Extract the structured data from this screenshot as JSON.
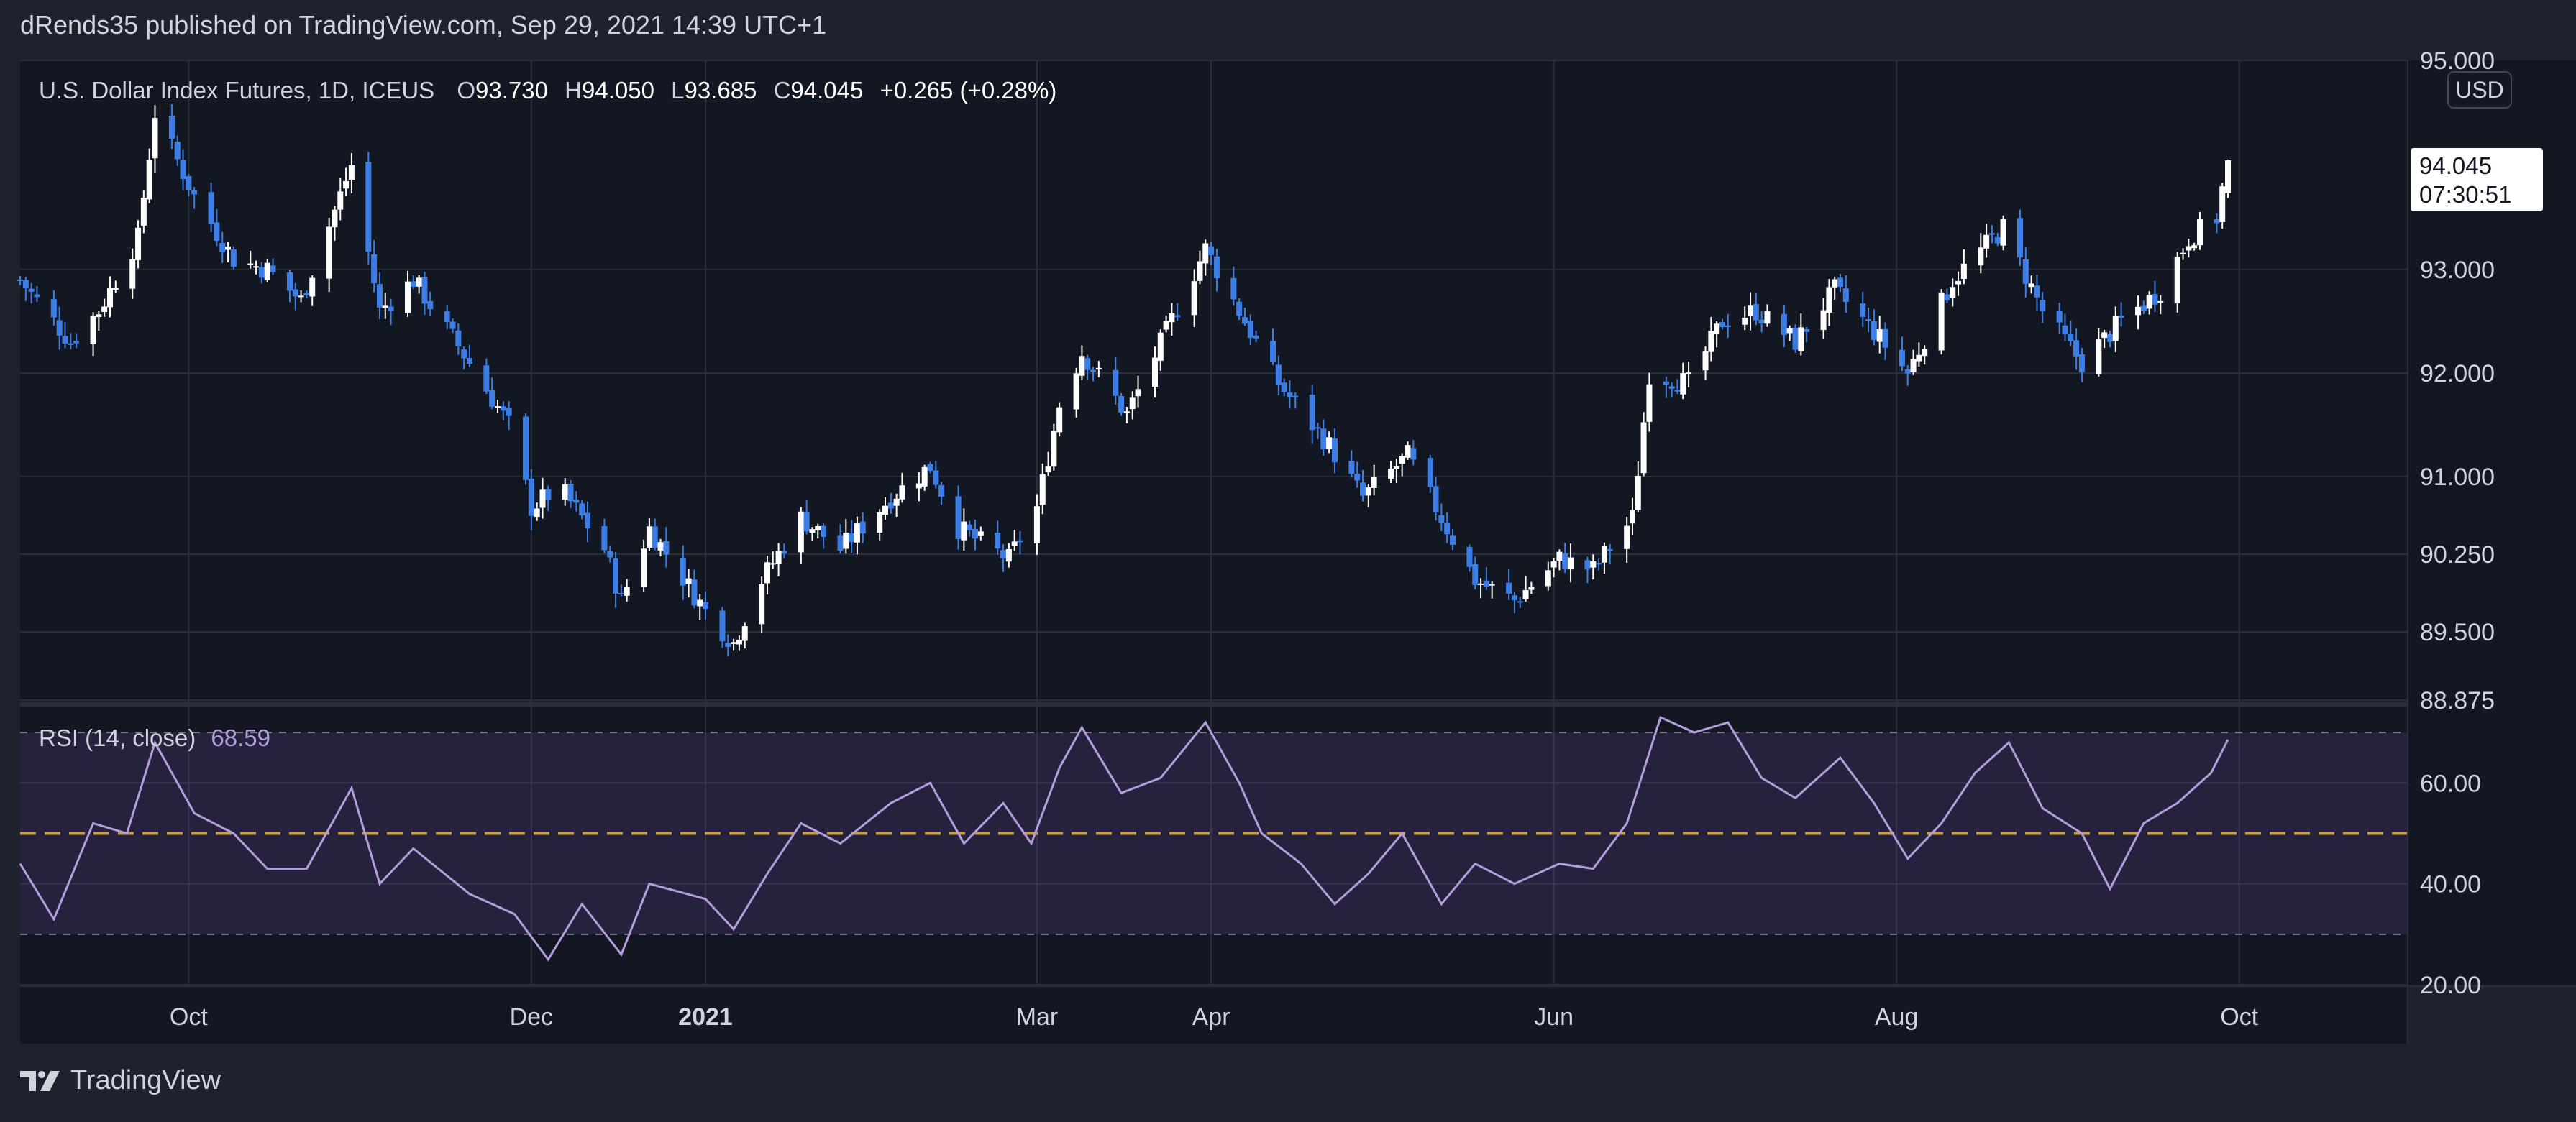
{
  "header": {
    "publisher": "dRends35 published on TradingView.com, Sep 29, 2021 14:39 UTC+1"
  },
  "footer": {
    "brand": "TradingView"
  },
  "colors": {
    "background": "#131722",
    "frame": "#1e222d",
    "grid": "#2a2e39",
    "up_candle": "#ffffff",
    "down_candle": "#3d7ee6",
    "rsi_line": "#b39ddb",
    "rsi_band": "#7e57c2",
    "rsi_mid": "#c9a14a",
    "text": "#d1d4dc"
  },
  "legend": {
    "symbol": "U.S. Dollar Index Futures, 1D, ICEUS",
    "o_label": "O",
    "o": "93.730",
    "h_label": "H",
    "h": "94.050",
    "l_label": "L",
    "l": "93.685",
    "c_label": "C",
    "c": "94.045",
    "change": "+0.265 (+0.28%)"
  },
  "price_axis": {
    "currency": "USD",
    "last_price": "94.045",
    "countdown": "07:30:51"
  },
  "rsi": {
    "label": "RSI (14, close)",
    "value": "68.59"
  },
  "chart_data": [
    {
      "type": "candlestick",
      "title": "U.S. Dollar Index Futures, 1D, ICEUS",
      "y_ticks": [
        "95.000",
        "93.000",
        "92.000",
        "91.000",
        "90.250",
        "89.500",
        "88.875"
      ],
      "x_ticks": [
        "Oct",
        "Dec",
        "2021",
        "Mar",
        "Apr",
        "Jun",
        "Aug",
        "Oct"
      ],
      "x_range": [
        "2020-09-01",
        "2021-10-31"
      ],
      "key_points": [
        {
          "date": "2020-09-01",
          "close": 92.9
        },
        {
          "date": "2020-09-10",
          "close": 92.3
        },
        {
          "date": "2020-09-15",
          "close": 92.6
        },
        {
          "date": "2020-09-22",
          "close": 93.3
        },
        {
          "date": "2020-09-25",
          "close": 94.5
        },
        {
          "date": "2020-10-02",
          "close": 93.7
        },
        {
          "date": "2020-10-09",
          "close": 93.1
        },
        {
          "date": "2020-10-15",
          "close": 93.0
        },
        {
          "date": "2020-10-21",
          "close": 92.7
        },
        {
          "date": "2020-10-30",
          "close": 94.0
        },
        {
          "date": "2020-11-04",
          "close": 92.6
        },
        {
          "date": "2020-11-10",
          "close": 92.9
        },
        {
          "date": "2020-11-20",
          "close": 92.1
        },
        {
          "date": "2020-11-27",
          "close": 91.5
        },
        {
          "date": "2020-12-01",
          "close": 90.7
        },
        {
          "date": "2020-12-06",
          "close": 90.9
        },
        {
          "date": "2020-12-14",
          "close": 90.3
        },
        {
          "date": "2020-12-17",
          "close": 89.8
        },
        {
          "date": "2020-12-22",
          "close": 90.5
        },
        {
          "date": "2021-01-01",
          "close": 89.7
        },
        {
          "date": "2021-01-06",
          "close": 89.4
        },
        {
          "date": "2021-01-11",
          "close": 90.0
        },
        {
          "date": "2021-01-18",
          "close": 90.6
        },
        {
          "date": "2021-01-25",
          "close": 90.3
        },
        {
          "date": "2021-02-03",
          "close": 90.8
        },
        {
          "date": "2021-02-10",
          "close": 91.1
        },
        {
          "date": "2021-02-15",
          "close": 90.5
        },
        {
          "date": "2021-02-24",
          "close": 90.2
        },
        {
          "date": "2021-03-01",
          "close": 90.7
        },
        {
          "date": "2021-03-05",
          "close": 91.7
        },
        {
          "date": "2021-03-09",
          "close": 92.2
        },
        {
          "date": "2021-03-17",
          "close": 91.6
        },
        {
          "date": "2021-03-24",
          "close": 92.4
        },
        {
          "date": "2021-03-31",
          "close": 93.2
        },
        {
          "date": "2021-04-06",
          "close": 92.6
        },
        {
          "date": "2021-04-13",
          "close": 91.9
        },
        {
          "date": "2021-04-22",
          "close": 91.3
        },
        {
          "date": "2021-04-28",
          "close": 90.8
        },
        {
          "date": "2021-05-06",
          "close": 91.2
        },
        {
          "date": "2021-05-12",
          "close": 90.6
        },
        {
          "date": "2021-05-18",
          "close": 90.0
        },
        {
          "date": "2021-05-25",
          "close": 89.8
        },
        {
          "date": "2021-06-02",
          "close": 90.2
        },
        {
          "date": "2021-06-08",
          "close": 90.1
        },
        {
          "date": "2021-06-15",
          "close": 90.6
        },
        {
          "date": "2021-06-18",
          "close": 92.0
        },
        {
          "date": "2021-06-25",
          "close": 91.9
        },
        {
          "date": "2021-07-01",
          "close": 92.5
        },
        {
          "date": "2021-07-07",
          "close": 92.6
        },
        {
          "date": "2021-07-14",
          "close": 92.3
        },
        {
          "date": "2021-07-21",
          "close": 92.8
        },
        {
          "date": "2021-07-28",
          "close": 92.4
        },
        {
          "date": "2021-08-03",
          "close": 92.0
        },
        {
          "date": "2021-08-11",
          "close": 92.9
        },
        {
          "date": "2021-08-20",
          "close": 93.4
        },
        {
          "date": "2021-08-27",
          "close": 92.6
        },
        {
          "date": "2021-09-03",
          "close": 92.1
        },
        {
          "date": "2021-09-10",
          "close": 92.5
        },
        {
          "date": "2021-09-17",
          "close": 92.8
        },
        {
          "date": "2021-09-22",
          "close": 93.3
        },
        {
          "date": "2021-09-27",
          "close": 93.5
        },
        {
          "date": "2021-09-29",
          "close": 94.045
        }
      ]
    },
    {
      "type": "line",
      "title": "RSI (14, close)",
      "y_ticks": [
        "60.00",
        "40.00",
        "20.00"
      ],
      "ylim": [
        20,
        75
      ],
      "bands": {
        "upper": 70,
        "middle": 50,
        "lower": 30
      },
      "points": [
        {
          "date": "2020-09-01",
          "y": 44
        },
        {
          "date": "2020-09-07",
          "y": 33
        },
        {
          "date": "2020-09-14",
          "y": 52
        },
        {
          "date": "2020-09-20",
          "y": 50
        },
        {
          "date": "2020-09-25",
          "y": 68
        },
        {
          "date": "2020-10-02",
          "y": 54
        },
        {
          "date": "2020-10-09",
          "y": 50
        },
        {
          "date": "2020-10-15",
          "y": 43
        },
        {
          "date": "2020-10-22",
          "y": 43
        },
        {
          "date": "2020-10-30",
          "y": 59
        },
        {
          "date": "2020-11-04",
          "y": 40
        },
        {
          "date": "2020-11-10",
          "y": 47
        },
        {
          "date": "2020-11-20",
          "y": 38
        },
        {
          "date": "2020-11-28",
          "y": 34
        },
        {
          "date": "2020-12-04",
          "y": 25
        },
        {
          "date": "2020-12-10",
          "y": 36
        },
        {
          "date": "2020-12-17",
          "y": 26
        },
        {
          "date": "2020-12-22",
          "y": 40
        },
        {
          "date": "2021-01-01",
          "y": 37
        },
        {
          "date": "2021-01-06",
          "y": 31
        },
        {
          "date": "2021-01-12",
          "y": 42
        },
        {
          "date": "2021-01-18",
          "y": 52
        },
        {
          "date": "2021-01-25",
          "y": 48
        },
        {
          "date": "2021-02-03",
          "y": 56
        },
        {
          "date": "2021-02-10",
          "y": 60
        },
        {
          "date": "2021-02-16",
          "y": 48
        },
        {
          "date": "2021-02-23",
          "y": 56
        },
        {
          "date": "2021-02-28",
          "y": 48
        },
        {
          "date": "2021-03-05",
          "y": 63
        },
        {
          "date": "2021-03-09",
          "y": 71
        },
        {
          "date": "2021-03-16",
          "y": 58
        },
        {
          "date": "2021-03-23",
          "y": 61
        },
        {
          "date": "2021-03-31",
          "y": 72
        },
        {
          "date": "2021-04-06",
          "y": 60
        },
        {
          "date": "2021-04-10",
          "y": 50
        },
        {
          "date": "2021-04-17",
          "y": 44
        },
        {
          "date": "2021-04-23",
          "y": 36
        },
        {
          "date": "2021-04-29",
          "y": 42
        },
        {
          "date": "2021-05-05",
          "y": 50
        },
        {
          "date": "2021-05-12",
          "y": 36
        },
        {
          "date": "2021-05-18",
          "y": 44
        },
        {
          "date": "2021-05-25",
          "y": 40
        },
        {
          "date": "2021-06-02",
          "y": 44
        },
        {
          "date": "2021-06-08",
          "y": 43
        },
        {
          "date": "2021-06-14",
          "y": 52
        },
        {
          "date": "2021-06-20",
          "y": 73
        },
        {
          "date": "2021-06-26",
          "y": 70
        },
        {
          "date": "2021-07-02",
          "y": 72
        },
        {
          "date": "2021-07-08",
          "y": 61
        },
        {
          "date": "2021-07-14",
          "y": 57
        },
        {
          "date": "2021-07-22",
          "y": 65
        },
        {
          "date": "2021-07-28",
          "y": 56
        },
        {
          "date": "2021-08-03",
          "y": 45
        },
        {
          "date": "2021-08-09",
          "y": 52
        },
        {
          "date": "2021-08-15",
          "y": 62
        },
        {
          "date": "2021-08-21",
          "y": 68
        },
        {
          "date": "2021-08-27",
          "y": 55
        },
        {
          "date": "2021-09-03",
          "y": 50
        },
        {
          "date": "2021-09-08",
          "y": 39
        },
        {
          "date": "2021-09-14",
          "y": 52
        },
        {
          "date": "2021-09-20",
          "y": 56
        },
        {
          "date": "2021-09-26",
          "y": 62
        },
        {
          "date": "2021-09-29",
          "y": 68.59
        }
      ]
    }
  ]
}
